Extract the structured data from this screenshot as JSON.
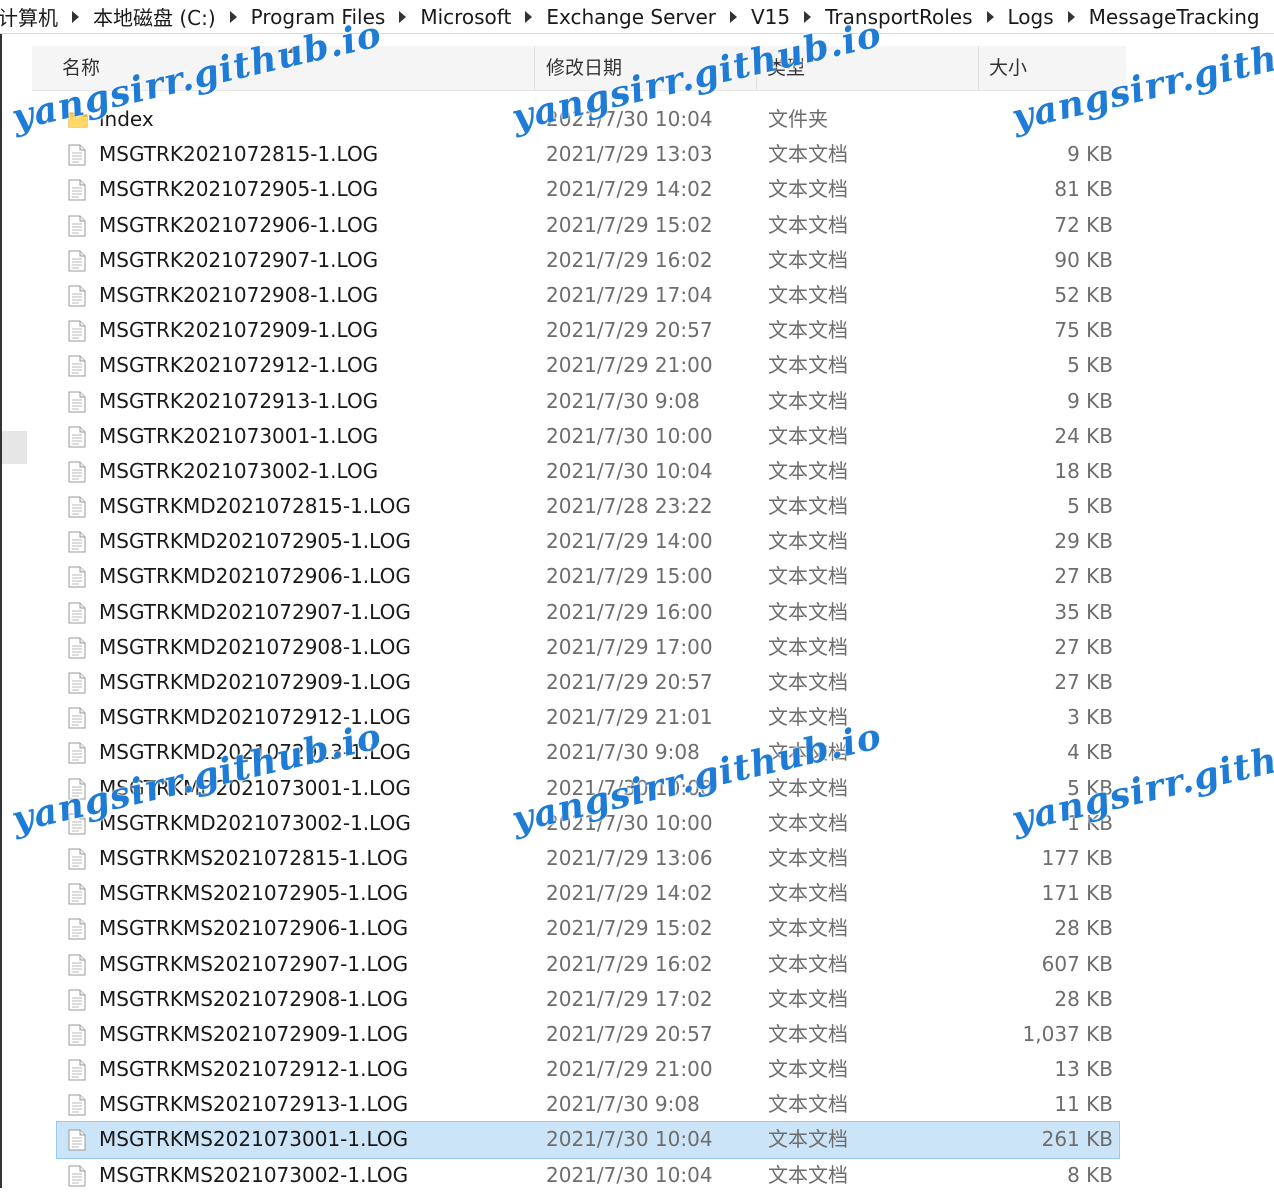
{
  "breadcrumb": [
    "计算机",
    "本地磁盘 (C:)",
    "Program Files",
    "Microsoft",
    "Exchange Server",
    "V15",
    "TransportRoles",
    "Logs",
    "MessageTracking"
  ],
  "columns": {
    "name": "名称",
    "date": "修改日期",
    "type": "类型",
    "size": "大小"
  },
  "files": [
    {
      "name": "index",
      "date": "2021/7/30 10:04",
      "type": "文件夹",
      "size": "",
      "icon": "folder-icon"
    },
    {
      "name": "MSGTRK2021072815-1.LOG",
      "date": "2021/7/29 13:03",
      "type": "文本文档",
      "size": "9 KB",
      "icon": "text-file-icon"
    },
    {
      "name": "MSGTRK2021072905-1.LOG",
      "date": "2021/7/29 14:02",
      "type": "文本文档",
      "size": "81 KB",
      "icon": "text-file-icon"
    },
    {
      "name": "MSGTRK2021072906-1.LOG",
      "date": "2021/7/29 15:02",
      "type": "文本文档",
      "size": "72 KB",
      "icon": "text-file-icon"
    },
    {
      "name": "MSGTRK2021072907-1.LOG",
      "date": "2021/7/29 16:02",
      "type": "文本文档",
      "size": "90 KB",
      "icon": "text-file-icon"
    },
    {
      "name": "MSGTRK2021072908-1.LOG",
      "date": "2021/7/29 17:04",
      "type": "文本文档",
      "size": "52 KB",
      "icon": "text-file-icon"
    },
    {
      "name": "MSGTRK2021072909-1.LOG",
      "date": "2021/7/29 20:57",
      "type": "文本文档",
      "size": "75 KB",
      "icon": "text-file-icon"
    },
    {
      "name": "MSGTRK2021072912-1.LOG",
      "date": "2021/7/29 21:00",
      "type": "文本文档",
      "size": "5 KB",
      "icon": "text-file-icon"
    },
    {
      "name": "MSGTRK2021072913-1.LOG",
      "date": "2021/7/30 9:08",
      "type": "文本文档",
      "size": "9 KB",
      "icon": "text-file-icon"
    },
    {
      "name": "MSGTRK2021073001-1.LOG",
      "date": "2021/7/30 10:00",
      "type": "文本文档",
      "size": "24 KB",
      "icon": "text-file-icon"
    },
    {
      "name": "MSGTRK2021073002-1.LOG",
      "date": "2021/7/30 10:04",
      "type": "文本文档",
      "size": "18 KB",
      "icon": "text-file-icon"
    },
    {
      "name": "MSGTRKMD2021072815-1.LOG",
      "date": "2021/7/28 23:22",
      "type": "文本文档",
      "size": "5 KB",
      "icon": "text-file-icon"
    },
    {
      "name": "MSGTRKMD2021072905-1.LOG",
      "date": "2021/7/29 14:00",
      "type": "文本文档",
      "size": "29 KB",
      "icon": "text-file-icon"
    },
    {
      "name": "MSGTRKMD2021072906-1.LOG",
      "date": "2021/7/29 15:00",
      "type": "文本文档",
      "size": "27 KB",
      "icon": "text-file-icon"
    },
    {
      "name": "MSGTRKMD2021072907-1.LOG",
      "date": "2021/7/29 16:00",
      "type": "文本文档",
      "size": "35 KB",
      "icon": "text-file-icon"
    },
    {
      "name": "MSGTRKMD2021072908-1.LOG",
      "date": "2021/7/29 17:00",
      "type": "文本文档",
      "size": "27 KB",
      "icon": "text-file-icon"
    },
    {
      "name": "MSGTRKMD2021072909-1.LOG",
      "date": "2021/7/29 20:57",
      "type": "文本文档",
      "size": "27 KB",
      "icon": "text-file-icon"
    },
    {
      "name": "MSGTRKMD2021072912-1.LOG",
      "date": "2021/7/29 21:01",
      "type": "文本文档",
      "size": "3 KB",
      "icon": "text-file-icon"
    },
    {
      "name": "MSGTRKMD2021072913-1.LOG",
      "date": "2021/7/30 9:08",
      "type": "文本文档",
      "size": "4 KB",
      "icon": "text-file-icon"
    },
    {
      "name": "MSGTRKMD2021073001-1.LOG",
      "date": "2021/7/30 10:00",
      "type": "文本文档",
      "size": "5 KB",
      "icon": "text-file-icon"
    },
    {
      "name": "MSGTRKMD2021073002-1.LOG",
      "date": "2021/7/30 10:00",
      "type": "文本文档",
      "size": "1 KB",
      "icon": "text-file-icon"
    },
    {
      "name": "MSGTRKMS2021072815-1.LOG",
      "date": "2021/7/29 13:06",
      "type": "文本文档",
      "size": "177 KB",
      "icon": "text-file-icon"
    },
    {
      "name": "MSGTRKMS2021072905-1.LOG",
      "date": "2021/7/29 14:02",
      "type": "文本文档",
      "size": "171 KB",
      "icon": "text-file-icon"
    },
    {
      "name": "MSGTRKMS2021072906-1.LOG",
      "date": "2021/7/29 15:02",
      "type": "文本文档",
      "size": "28 KB",
      "icon": "text-file-icon"
    },
    {
      "name": "MSGTRKMS2021072907-1.LOG",
      "date": "2021/7/29 16:02",
      "type": "文本文档",
      "size": "607 KB",
      "icon": "text-file-icon"
    },
    {
      "name": "MSGTRKMS2021072908-1.LOG",
      "date": "2021/7/29 17:02",
      "type": "文本文档",
      "size": "28 KB",
      "icon": "text-file-icon"
    },
    {
      "name": "MSGTRKMS2021072909-1.LOG",
      "date": "2021/7/29 20:57",
      "type": "文本文档",
      "size": "1,037 KB",
      "icon": "text-file-icon"
    },
    {
      "name": "MSGTRKMS2021072912-1.LOG",
      "date": "2021/7/29 21:00",
      "type": "文本文档",
      "size": "13 KB",
      "icon": "text-file-icon"
    },
    {
      "name": "MSGTRKMS2021072913-1.LOG",
      "date": "2021/7/30 9:08",
      "type": "文本文档",
      "size": "11 KB",
      "icon": "text-file-icon"
    },
    {
      "name": "MSGTRKMS2021073001-1.LOG",
      "date": "2021/7/30 10:04",
      "type": "文本文档",
      "size": "261 KB",
      "icon": "text-file-icon",
      "selected": true
    },
    {
      "name": "MSGTRKMS2021073002-1.LOG",
      "date": "2021/7/30 10:04",
      "type": "文本文档",
      "size": "8 KB",
      "icon": "text-file-icon"
    }
  ],
  "watermark": {
    "text": "yangsirr.github.io",
    "text_cut": "yangsirr.github",
    "color": "#1e7bd6"
  },
  "colors": {
    "selection": "#cce4f7",
    "header_bg": "#f5f5f5",
    "muted_text": "#6d6d6d"
  }
}
